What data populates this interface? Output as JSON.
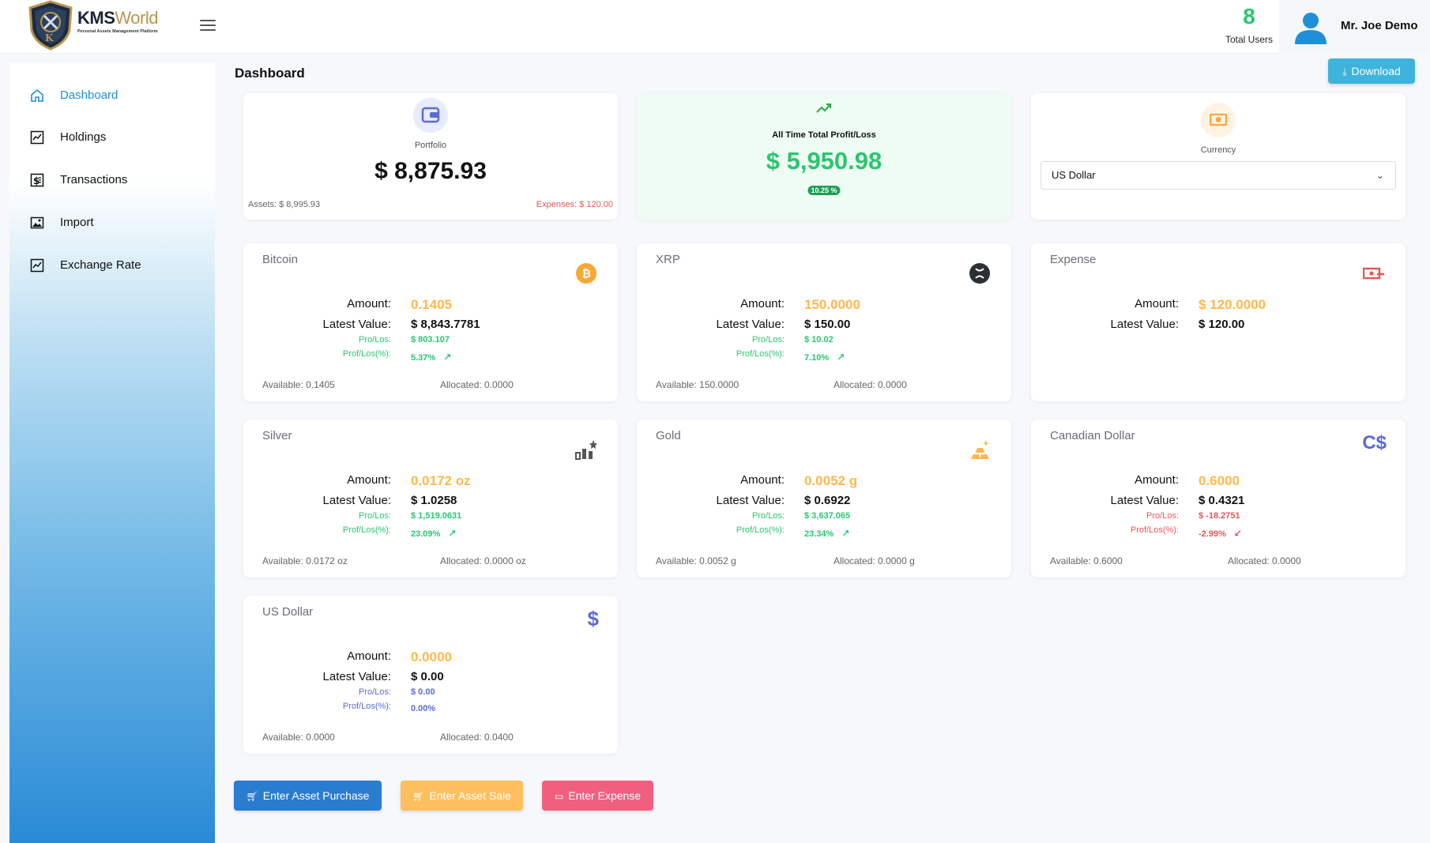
{
  "app": {
    "brand_main": "KMS",
    "brand_accent": "World",
    "brand_tagline": "Personal Assets Management Platform"
  },
  "header": {
    "total_users_count": "8",
    "total_users_label": "Total Users",
    "user_name": "Mr. Joe Demo"
  },
  "sidebar": {
    "items": [
      {
        "label": "Dashboard",
        "icon": "home-icon",
        "active": true
      },
      {
        "label": "Holdings",
        "icon": "chart-icon"
      },
      {
        "label": "Transactions",
        "icon": "receipt-dollar-icon"
      },
      {
        "label": "Import",
        "icon": "image-icon"
      },
      {
        "label": "Exchange Rate",
        "icon": "chart-icon"
      }
    ]
  },
  "page": {
    "title": "Dashboard",
    "download_label": "Download"
  },
  "summary": {
    "portfolio": {
      "label": "Portfolio",
      "value": "$ 8,875.93",
      "assets": "Assets: $ 8,995.93",
      "expenses": "Expenses: $ 120.00"
    },
    "profit": {
      "label": "All Time Total Profit/Loss",
      "value": "$ 5,950.98",
      "badge": "10.25 %"
    },
    "currency": {
      "label": "Currency",
      "selected": "US Dollar"
    }
  },
  "assets": [
    {
      "name": "Bitcoin",
      "icon": "bitcoin-icon",
      "amount": "0.1405",
      "latest": "$ 8,843.7781",
      "pl": "$ 803.107",
      "plpct": "5.37%",
      "trend": "up",
      "available": "Available: 0.1405",
      "allocated": "Allocated: 0.0000"
    },
    {
      "name": "XRP",
      "icon": "xrp-icon",
      "amount": "150.0000",
      "latest": "$ 150.00",
      "pl": "$ 10.02",
      "plpct": "7.10%",
      "trend": "up",
      "available": "Available: 150.0000",
      "allocated": "Allocated: 0.0000"
    },
    {
      "name": "Expense",
      "icon": "money-bill-icon",
      "amount": "$ 120.0000",
      "latest": "$ 120.00"
    },
    {
      "name": "Silver",
      "icon": "silver-chart-icon",
      "amount": "0.0172 oz",
      "latest": "$ 1.0258",
      "pl": "$ 1,519.0631",
      "plpct": "23.09%",
      "trend": "up",
      "available": "Available: 0.0172 oz",
      "allocated": "Allocated: 0.0000 oz"
    },
    {
      "name": "Gold",
      "icon": "gold-bars-icon",
      "amount": "0.0052 g",
      "latest": "$ 0.6922",
      "pl": "$ 3,637.065",
      "plpct": "23.34%",
      "trend": "up",
      "available": "Available: 0.0052 g",
      "allocated": "Allocated: 0.0000 g"
    },
    {
      "name": "Canadian Dollar",
      "icon": "cad-icon",
      "amount": "0.6000",
      "latest": "$ 0.4321",
      "pl": "$ -18.2751",
      "plpct": "-2.99%",
      "trend": "down",
      "available": "Available: 0.6000",
      "allocated": "Allocated: 0.0000"
    },
    {
      "name": "US Dollar",
      "icon": "dollar-icon",
      "amount": "0.0000",
      "latest": "$ 0.00",
      "pl": "$ 0.00",
      "plpct": "0.00%",
      "trend": "flat",
      "available": "Available: 0.0000",
      "allocated": "Allocated: 0.0400"
    }
  ],
  "labels": {
    "amount": "Amount:",
    "latest": "Latest Value:",
    "pl": "Pro/Los:",
    "plpct": "Prof/Los(%):"
  },
  "actions": {
    "purchase": "Enter Asset Purchase",
    "sale": "Enter Asset Sale",
    "expense": "Enter Expense"
  },
  "colors": {
    "primary": "#1f8fd8",
    "green": "#28c76f",
    "red": "#ea5455",
    "amber": "#ffb74d",
    "purple": "#5b6bd6"
  }
}
